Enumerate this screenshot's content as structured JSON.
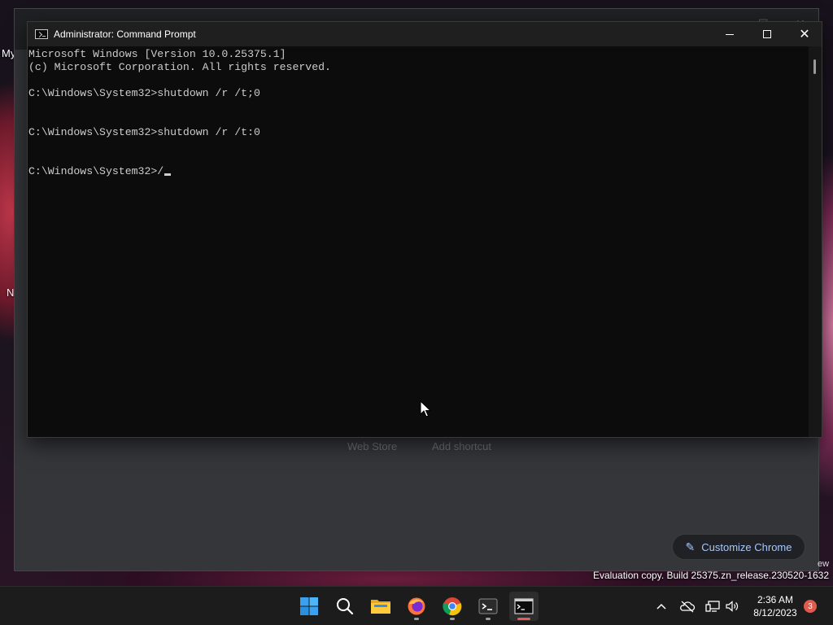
{
  "desktop": {
    "labels": [
      "My",
      "N"
    ],
    "evaluation_text": "Evaluation copy. Build 25375.zn_release.230520-1632",
    "partial_text": "ew"
  },
  "chrome_window": {
    "shortcut_labels": [
      "Web Store",
      "Add shortcut"
    ],
    "customize_label": "Customize Chrome",
    "accent": "#a8c7fa"
  },
  "cmd_window": {
    "title": "Administrator: Command Prompt",
    "lines": [
      "Microsoft Windows [Version 10.0.25375.1]",
      "(c) Microsoft Corporation. All rights reserved.",
      "",
      "C:\\Windows\\System32>shutdown /r /t;0",
      "",
      "",
      "C:\\Windows\\System32>shutdown /r /t:0",
      "",
      "",
      "C:\\Windows\\System32>/"
    ],
    "background": "#0c0c0c",
    "foreground": "#cccccc"
  },
  "taskbar": {
    "apps": [
      "windows-start-icon",
      "search-icon",
      "file-explorer-icon",
      "firefox-icon",
      "chrome-icon",
      "terminal-icon",
      "command-prompt-icon"
    ],
    "tray_icons": [
      "chevron-up-icon",
      "onedrive-offline-icon",
      "network-icon",
      "volume-icon"
    ],
    "time": "2:36 AM",
    "date": "8/12/2023",
    "notification_count": "3"
  }
}
